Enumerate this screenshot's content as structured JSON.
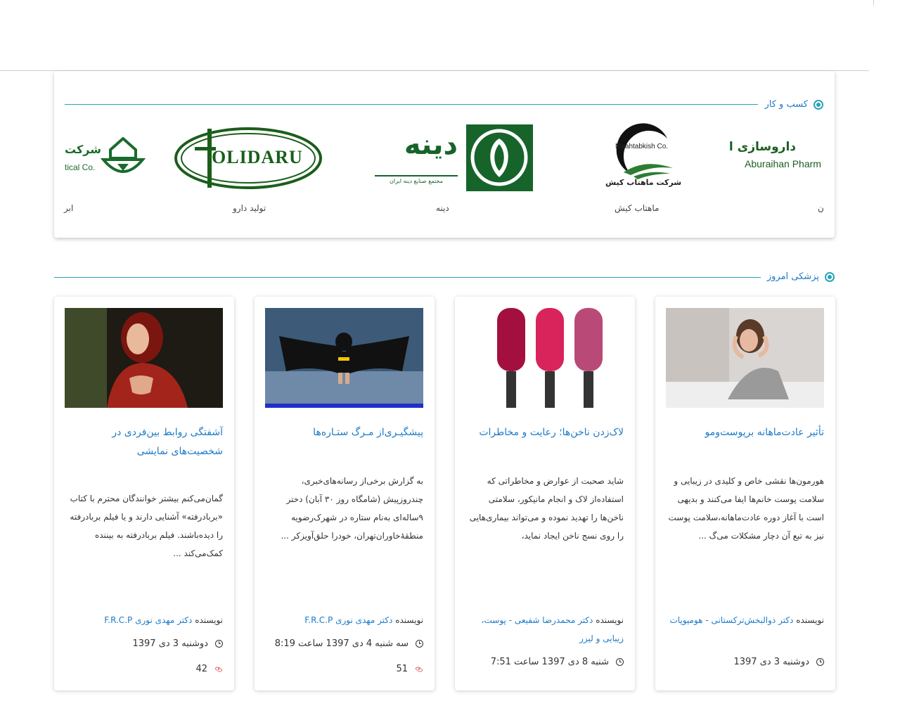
{
  "business": {
    "section_title": "کسب و کار",
    "logos": [
      {
        "caption": "ن",
        "logo_text": "داروسازی ابوریحان",
        "logo_subtext": "Aburaihan Pharm",
        "color": "#1b5e20"
      },
      {
        "caption": "ماهتاب کیش",
        "logo_text": "Maahtabkish Co.",
        "logo_subtext": "شرکت ماهتاب کیش",
        "color": "#222222"
      },
      {
        "caption": "دینه",
        "logo_text": "دینه",
        "logo_subtext": "مجتمع صنایع دینه ایران",
        "color": "#17642b"
      },
      {
        "caption": "تولید دارو",
        "logo_text": "OLIDARU",
        "color": "#1a5e1a"
      },
      {
        "caption": "ابر",
        "logo_text": "شرکت",
        "logo_subtext": "tical Co.",
        "color": "#1a6b2c"
      }
    ]
  },
  "medicine": {
    "section_title": "پزشکی امروز",
    "author_label": "نویسنده",
    "articles": [
      {
        "title": "تأثیر عادت‌ماهانه برپوست‌ومو",
        "excerpt": "هورمون‌ها نقشی خاص و کلیدی در زیبایی و سلامت پوست خانم‌ها ایفا می‌کنند و بدیهی است با آغاز دوره عادت‌ماهانه،سلامت پوست نیز به تبع آن دچار مشکلات می‌گ ...",
        "author": "دکتر ذوالبخش‌ترکستانی - هومیوپات",
        "date": "دوشنبه 3 دی 1397"
      },
      {
        "title": "لاک‌زدن ناخن‌ها؛ رعایت و مخاطرات",
        "excerpt": "شاید صحبت از عوارض و مخاطراتی که استفاده‌از لاک و انجام مانیکور، سلامتی ناخن‌ها را تهدید نموده و می‌تواند بیماری‌هایی را روی نسج ناخن ایجاد نماید،",
        "author": "دکتر محمدرضا شفیعی - پوست، زیبایی و لیزر",
        "date": "شنبه 8 دی 1397 ساعت 7:51"
      },
      {
        "title": "پیشگیـری‌از مـرگ ستـاره‌ها",
        "excerpt": "به گزارش برخی‌از رسانه‌های‌خبری، چندروزپیش (شامگاه روز ۳۰ آبان) دختر ۹ساله‌ای به‌نام ستاره در شهرک‌رضویه منطقهٔ‌خاوران‌تهران، خودرا حلق‌آویزکر ...",
        "author": "دکتر مهدی نوری F.R.C.P",
        "date": "سه شنبه 4 دی 1397 ساعت 8:19",
        "views": "51"
      },
      {
        "title": "آشفتگی روابط بین‌فردی در شخصیت‌های نمایشی",
        "excerpt": "گمان‌می‌کنم بیشتر خوانندگان محترم با کتاب «برباد‌رفته» آشنایی دارند و یا فیلم بربادرفته را دیده‌باشند. فیلم بربادرفته به بیننده کمک‌می‌کند ...",
        "author": "دکتر مهدی نوری F.R.C.P",
        "date": "دوشنبه 3 دی 1397",
        "views": "42"
      }
    ]
  }
}
